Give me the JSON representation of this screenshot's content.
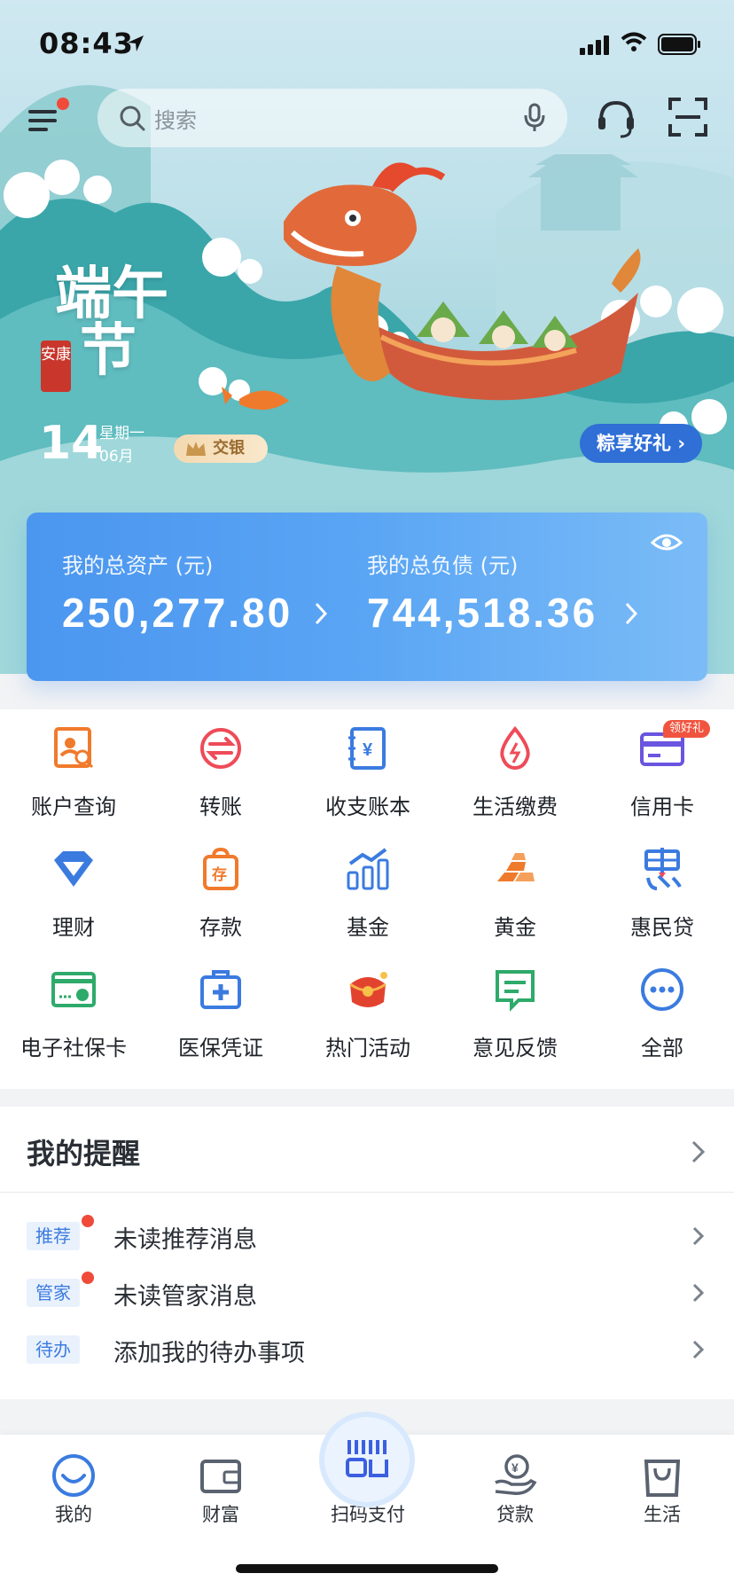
{
  "status_bar": {
    "time": "08:43"
  },
  "search": {
    "placeholder": "搜索"
  },
  "banner": {
    "calligraphy_line1": "端午",
    "calligraphy_line2": "节",
    "seal_text": "安康",
    "day": "14",
    "weekday": "星期一",
    "month": "06月",
    "brand_tag": "交银",
    "promo_label": "粽享好礼 ›"
  },
  "assets": {
    "total_assets_label": "我的总资产 (元)",
    "total_assets_value": "250,277.80",
    "total_liabilities_label": "我的总负债 (元)",
    "total_liabilities_value": "744,518.36"
  },
  "quick_grid": {
    "badge": "领好礼",
    "items": [
      {
        "label": "账户查询",
        "icon": "account-query-icon"
      },
      {
        "label": "转账",
        "icon": "transfer-icon"
      },
      {
        "label": "收支账本",
        "icon": "ledger-icon"
      },
      {
        "label": "生活缴费",
        "icon": "bill-pay-icon"
      },
      {
        "label": "信用卡",
        "icon": "credit-card-icon"
      },
      {
        "label": "理财",
        "icon": "wealth-diamond-icon"
      },
      {
        "label": "存款",
        "icon": "deposit-icon"
      },
      {
        "label": "基金",
        "icon": "fund-chart-icon"
      },
      {
        "label": "黄金",
        "icon": "gold-bars-icon"
      },
      {
        "label": "惠民贷",
        "icon": "loan-hui-icon"
      },
      {
        "label": "电子社保卡",
        "icon": "social-security-card-icon"
      },
      {
        "label": "医保凭证",
        "icon": "medical-insurance-icon"
      },
      {
        "label": "热门活动",
        "icon": "hot-activity-icon"
      },
      {
        "label": "意见反馈",
        "icon": "feedback-icon"
      },
      {
        "label": "全部",
        "icon": "all-more-icon"
      }
    ]
  },
  "reminders": {
    "title": "我的提醒",
    "items": [
      {
        "tag": "推荐",
        "text": "未读推荐消息",
        "unread": true
      },
      {
        "tag": "管家",
        "text": "未读管家消息",
        "unread": true
      },
      {
        "tag": "待办",
        "text": "添加我的待办事项",
        "unread": false
      }
    ]
  },
  "tabbar": {
    "items": [
      {
        "label": "我的",
        "icon": "smile-face-icon",
        "active": true
      },
      {
        "label": "财富",
        "icon": "wallet-icon"
      },
      {
        "label": "扫码支付",
        "icon": "scan-pay-icon"
      },
      {
        "label": "贷款",
        "icon": "loan-hand-icon"
      },
      {
        "label": "生活",
        "icon": "shopping-bag-icon"
      }
    ]
  },
  "colors": {
    "accent_blue": "#3b7be0",
    "card_gradient_start": "#4b96ef",
    "card_gradient_end": "#7bbcf7",
    "alert_red": "#f04a3a",
    "promo_blue": "#2f6fd6"
  }
}
